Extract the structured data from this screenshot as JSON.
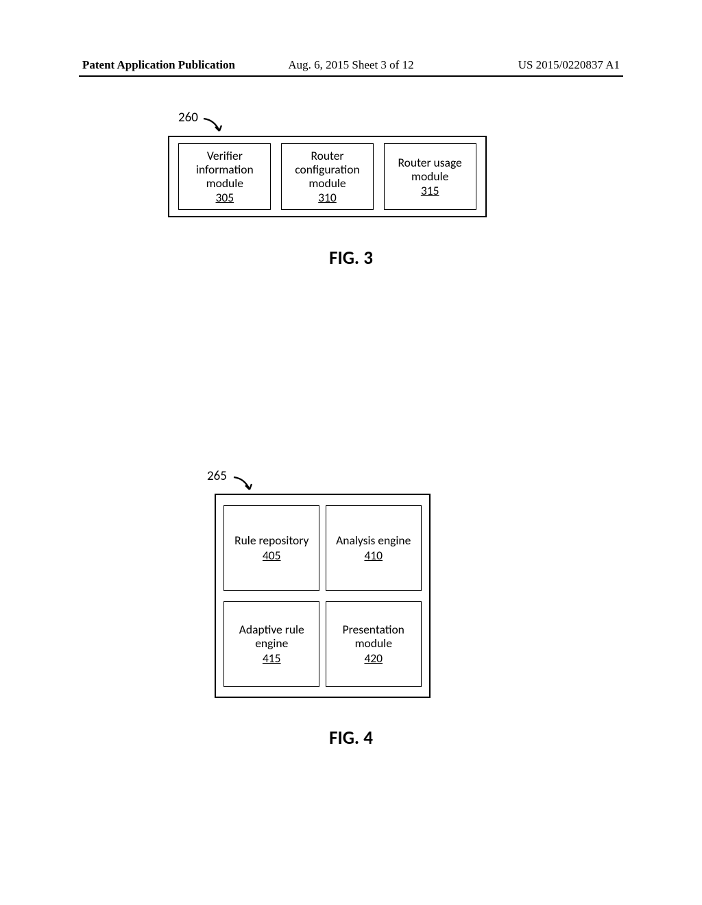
{
  "header": {
    "left": "Patent Application Publication",
    "center": "Aug. 6, 2015  Sheet 3 of 12",
    "right": "US 2015/0220837 A1"
  },
  "fig3": {
    "ref": "260",
    "label": "FIG. 3",
    "modules": [
      {
        "name": "Verifier information module",
        "num": "305"
      },
      {
        "name": "Router configuration module",
        "num": "310"
      },
      {
        "name": "Router usage module",
        "num": "315"
      }
    ]
  },
  "fig4": {
    "ref": "265",
    "label": "FIG. 4",
    "modules": [
      {
        "name": "Rule repository",
        "num": "405"
      },
      {
        "name": "Analysis engine",
        "num": "410"
      },
      {
        "name": "Adaptive rule engine",
        "num": "415"
      },
      {
        "name": "Presentation module",
        "num": "420"
      }
    ]
  }
}
